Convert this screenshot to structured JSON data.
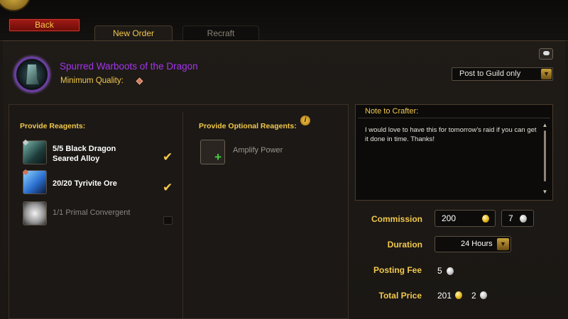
{
  "buttons": {
    "back": "Back"
  },
  "tabs": [
    {
      "label": "New Order"
    },
    {
      "label": "Recraft"
    }
  ],
  "item": {
    "name": "Spurred Warboots of the Dragon",
    "min_quality_label": "Minimum Quality:",
    "name_color": "#a335ee"
  },
  "post_select": {
    "value": "Post to Guild only"
  },
  "reagents": {
    "header": "Provide Reagents:",
    "items": [
      {
        "name_line1": "5/5 Black Dragon",
        "name_line2": "Seared Alloy",
        "checked": true,
        "icon": "black-dragon-alloy-icon"
      },
      {
        "name_line1": "20/20 Tyrivite Ore",
        "checked": true,
        "icon": "tyrivite-ore-icon"
      },
      {
        "name_line1": "1/1 Primal Convergent",
        "checked": false,
        "icon": "primal-convergent-icon"
      }
    ]
  },
  "optional_reagents": {
    "header": "Provide Optional Reagents:",
    "items": [
      {
        "name": "Amplify Power"
      }
    ]
  },
  "note": {
    "title": "Note to Crafter:",
    "text": "I would love to have this for tomorrow's raid if you can get it done in time. Thanks!"
  },
  "order": {
    "commission_label": "Commission",
    "commission_gold": "200",
    "commission_silver": "7",
    "duration_label": "Duration",
    "duration_value": "24 Hours",
    "posting_fee_label": "Posting Fee",
    "posting_fee_silver": "5",
    "total_label": "Total Price",
    "total_gold": "201",
    "total_silver": "2"
  },
  "colors": {
    "accent_gold": "#f2c94c",
    "epic_purple": "#a335ee",
    "back_red": "#a21a14"
  }
}
